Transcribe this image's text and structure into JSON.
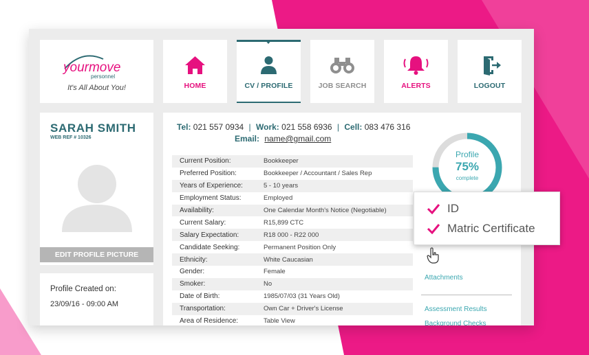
{
  "brand": {
    "logo_text": "yourmove",
    "logo_sub": "personnel",
    "tagline": "It's All About You!",
    "accent_pink": "#e6117f",
    "accent_teal": "#2c6a72"
  },
  "nav": [
    {
      "label": "HOME",
      "icon": "home-icon"
    },
    {
      "label": "CV / PROFILE",
      "icon": "user-icon",
      "active": true
    },
    {
      "label": "JOB SEARCH",
      "icon": "binoculars-icon"
    },
    {
      "label": "ALERTS",
      "icon": "bell-icon"
    },
    {
      "label": "LOGOUT",
      "icon": "logout-icon"
    }
  ],
  "profile": {
    "name": "SARAH SMITH",
    "web_ref": "WEB REF # 10326",
    "edit_picture_label": "EDIT PROFILE PICTURE",
    "created_label": "Profile Created on:",
    "created_value": "23/09/16 - 09:00 AM"
  },
  "contact": {
    "tel_label": "Tel:",
    "tel": "021 557 0934",
    "work_label": "Work:",
    "work": "021 558 6936",
    "cell_label": "Cell:",
    "cell": "083 476 316",
    "email_label": "Email:",
    "email": "name@gmail.com",
    "sep": "|"
  },
  "details": [
    {
      "key": "Current Position:",
      "value": "Bookkeeper"
    },
    {
      "key": "Preferred Position:",
      "value": "Bookkeeper / Accountant / Sales Rep"
    },
    {
      "key": "Years of Experience:",
      "value": "5 - 10 years"
    },
    {
      "key": "Employment Status:",
      "value": "Employed"
    },
    {
      "key": "Availability:",
      "value": "One Calendar Month's Notice (Negotiable)"
    },
    {
      "key": "Current Salary:",
      "value": "R15,899 CTC"
    },
    {
      "key": "Salary Expectation:",
      "value": "R18 000 - R22 000"
    },
    {
      "key": "Candidate Seeking:",
      "value": "Permanent Position Only"
    },
    {
      "key": "Ethnicity:",
      "value": "White Caucasian"
    },
    {
      "key": "Gender:",
      "value": "Female"
    },
    {
      "key": "Smoker:",
      "value": "No"
    },
    {
      "key": "Date of Birth:",
      "value": "1985/07/03 (31 Years Old)"
    },
    {
      "key": "Transportation:",
      "value": "Own Car + Driver's License"
    },
    {
      "key": "Area of Residence:",
      "value": "Table View"
    }
  ],
  "completion": {
    "label": "Profile",
    "percent_text": "75%",
    "sub": "complete",
    "fraction": 0.75
  },
  "side_links": {
    "attachments": "Attachments",
    "assessment": "Assessment Results",
    "background": "Background Checks"
  },
  "popup": {
    "items": [
      "ID",
      "Matric Certificate"
    ]
  }
}
